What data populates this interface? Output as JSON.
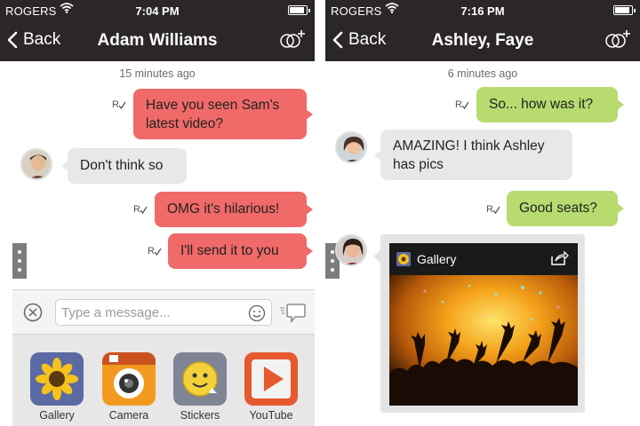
{
  "left": {
    "status": {
      "carrier": "ROGERS",
      "time": "7:04 PM",
      "battery_level": 0.9
    },
    "nav": {
      "back_label": "Back",
      "title": "Adam Williams"
    },
    "timestamp": "15 minutes ago",
    "messages": [
      {
        "text": "Have you seen Sam's latest video?",
        "direction": "outgoing",
        "color": "#f06a69"
      },
      {
        "text": "Don't think so",
        "direction": "incoming",
        "color": "#e8e8e8"
      },
      {
        "text": "OMG it's hilarious!",
        "direction": "outgoing",
        "color": "#f06a69"
      },
      {
        "text": "I'll send it to you",
        "direction": "outgoing",
        "color": "#f06a69"
      }
    ],
    "compose": {
      "placeholder": "Type a message..."
    },
    "apps": [
      {
        "label": "Gallery",
        "icon": "sunflower-icon"
      },
      {
        "label": "Camera",
        "icon": "camera-icon"
      },
      {
        "label": "Stickers",
        "icon": "sticker-face-icon"
      },
      {
        "label": "YouTube",
        "icon": "play-icon"
      }
    ]
  },
  "right": {
    "status": {
      "carrier": "ROGERS",
      "time": "7:16 PM",
      "battery_level": 0.9
    },
    "nav": {
      "back_label": "Back",
      "title": "Ashley, Faye"
    },
    "timestamp": "6 minutes ago",
    "messages": [
      {
        "text": "So... how was it?",
        "direction": "outgoing",
        "color": "#b7db6f"
      },
      {
        "text": "AMAZING! I think Ashley has pics",
        "direction": "incoming",
        "color": "#e8e8e8"
      },
      {
        "text": "Good seats?",
        "direction": "outgoing",
        "color": "#b7db6f"
      }
    ],
    "gallery": {
      "title": "Gallery",
      "photo": "concert-crowd-photo"
    }
  },
  "colors": {
    "bar": "#2b2726",
    "outgoing_left": "#f06a69",
    "outgoing_right": "#b7db6f",
    "incoming": "#e8e8e8"
  }
}
